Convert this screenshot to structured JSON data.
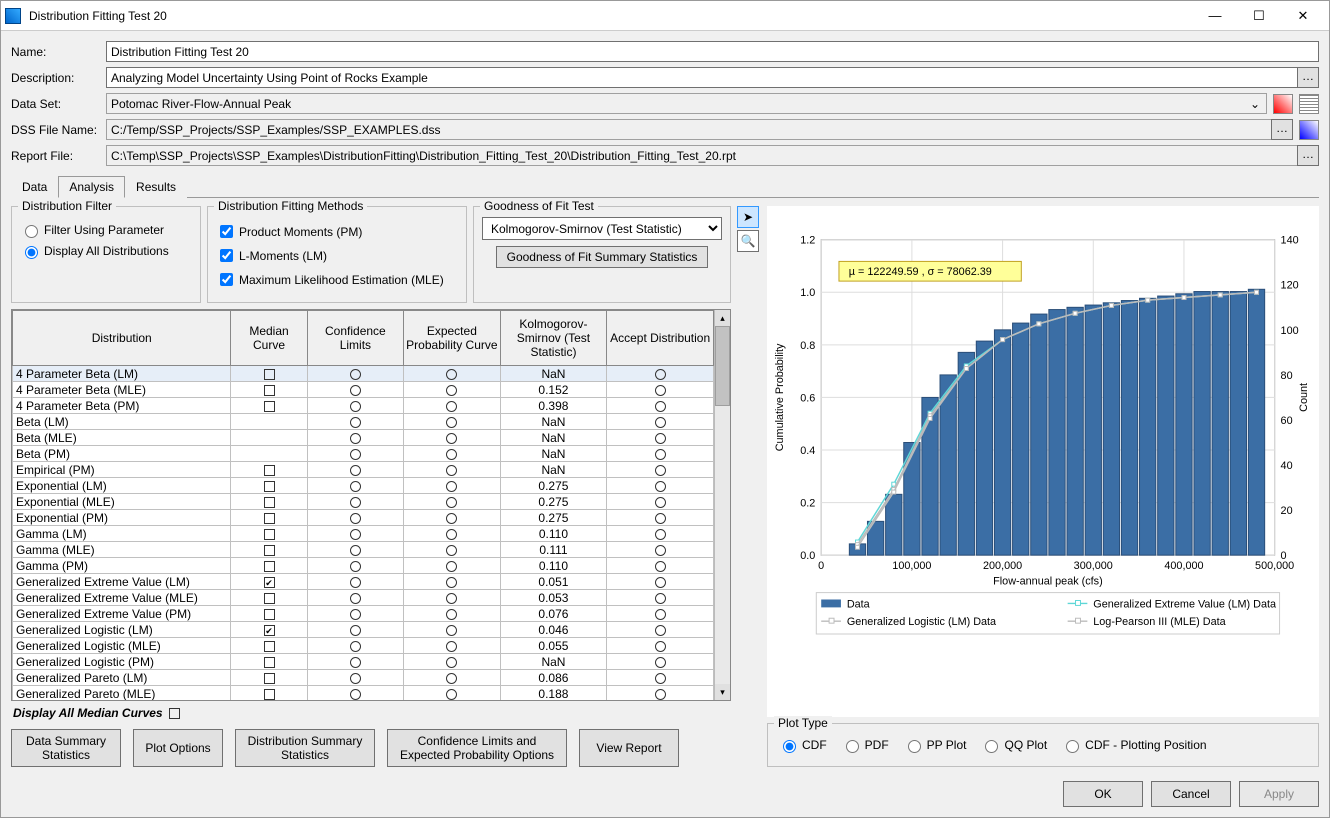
{
  "window_title": "Distribution Fitting Test 20",
  "form": {
    "name_label": "Name:",
    "name_value": "Distribution Fitting Test 20",
    "desc_label": "Description:",
    "desc_value": "Analyzing Model Uncertainty Using Point of Rocks Example",
    "dataset_label": "Data Set:",
    "dataset_value": "Potomac River-Flow-Annual Peak",
    "dss_label": "DSS File Name:",
    "dss_value": "C:/Temp/SSP_Projects/SSP_Examples/SSP_EXAMPLES.dss",
    "report_label": "Report File:",
    "report_value": "C:\\Temp\\SSP_Projects\\SSP_Examples\\DistributionFitting\\Distribution_Fitting_Test_20\\Distribution_Fitting_Test_20.rpt"
  },
  "tabs": {
    "data": "Data",
    "analysis": "Analysis",
    "results": "Results"
  },
  "filter_group": {
    "title": "Distribution Filter",
    "using_param": "Filter Using Parameter",
    "display_all": "Display All Distributions"
  },
  "methods_group": {
    "title": "Distribution Fitting Methods",
    "pm": "Product Moments (PM)",
    "lm": "L-Moments (LM)",
    "mle": "Maximum Likelihood Estimation (MLE)"
  },
  "gof_group": {
    "title": "Goodness of Fit Test",
    "selected": "Kolmogorov-Smirnov (Test Statistic)",
    "summary_btn": "Goodness of Fit Summary Statistics"
  },
  "table": {
    "headers": {
      "dist": "Distribution",
      "median": "Median Curve",
      "conf": "Confidence Limits",
      "exp": "Expected Probability Curve",
      "ks": "Kolmogorov-Smirnov (Test Statistic)",
      "accept": "Accept Distribution"
    },
    "rows": [
      {
        "name": "4 Parameter Beta (LM)",
        "median": false,
        "ks": "NaN"
      },
      {
        "name": "4 Parameter Beta (MLE)",
        "median": false,
        "ks": "0.152"
      },
      {
        "name": "4 Parameter Beta (PM)",
        "median": false,
        "ks": "0.398"
      },
      {
        "name": "Beta (LM)",
        "median": null,
        "ks": "NaN"
      },
      {
        "name": "Beta (MLE)",
        "median": null,
        "ks": "NaN"
      },
      {
        "name": "Beta (PM)",
        "median": null,
        "ks": "NaN"
      },
      {
        "name": "Empirical (PM)",
        "median": false,
        "ks": "NaN"
      },
      {
        "name": "Exponential (LM)",
        "median": false,
        "ks": "0.275"
      },
      {
        "name": "Exponential (MLE)",
        "median": false,
        "ks": "0.275"
      },
      {
        "name": "Exponential (PM)",
        "median": false,
        "ks": "0.275"
      },
      {
        "name": "Gamma (LM)",
        "median": false,
        "ks": "0.110"
      },
      {
        "name": "Gamma (MLE)",
        "median": false,
        "ks": "0.111"
      },
      {
        "name": "Gamma (PM)",
        "median": false,
        "ks": "0.110"
      },
      {
        "name": "Generalized Extreme Value (LM)",
        "median": true,
        "ks": "0.051"
      },
      {
        "name": "Generalized Extreme Value (MLE)",
        "median": false,
        "ks": "0.053"
      },
      {
        "name": "Generalized Extreme Value (PM)",
        "median": false,
        "ks": "0.076"
      },
      {
        "name": "Generalized Logistic (LM)",
        "median": true,
        "ks": "0.046"
      },
      {
        "name": "Generalized Logistic (MLE)",
        "median": false,
        "ks": "0.055"
      },
      {
        "name": "Generalized Logistic (PM)",
        "median": false,
        "ks": "NaN"
      },
      {
        "name": "Generalized Pareto (LM)",
        "median": false,
        "ks": "0.086"
      },
      {
        "name": "Generalized Pareto (MLE)",
        "median": false,
        "ks": "0.188"
      }
    ]
  },
  "display_all_median": "Display All Median Curves",
  "bottom_buttons": {
    "data_summary": "Data Summary Statistics",
    "plot_options": "Plot Options",
    "dist_summary": "Distribution Summary Statistics",
    "conf_exp": "Confidence Limits and Expected Probability Options",
    "view_report": "View Report"
  },
  "chart_annotation": "µ = 122249.59 , σ = 78062.39",
  "legend": {
    "data": "Data",
    "gev": "Generalized Extreme Value (LM) Data",
    "glog": "Generalized Logistic (LM) Data",
    "lp3": "Log-Pearson III (MLE) Data"
  },
  "axes": {
    "left": "Cumulative Probability",
    "bottom": "Flow-annual peak (cfs)",
    "right": "Count"
  },
  "plot_type": {
    "title": "Plot Type",
    "cdf": "CDF",
    "pdf": "PDF",
    "pp": "PP Plot",
    "qq": "QQ Plot",
    "cdfpp": "CDF - Plotting Position"
  },
  "footer": {
    "ok": "OK",
    "cancel": "Cancel",
    "apply": "Apply"
  },
  "chart_data": {
    "type": "bar+line",
    "title": "",
    "xlabel": "Flow-annual peak (cfs)",
    "ylabel_left": "Cumulative Probability",
    "ylabel_right": "Count",
    "xlim": [
      0,
      500000
    ],
    "ylim_left": [
      0.0,
      1.2
    ],
    "ylim_right": [
      0,
      140
    ],
    "xticks": [
      0,
      100000,
      200000,
      300000,
      400000,
      500000
    ],
    "yticks_left": [
      0.0,
      0.2,
      0.4,
      0.6,
      0.8,
      1.0,
      1.2
    ],
    "yticks_right": [
      0,
      20,
      40,
      60,
      80,
      100,
      120,
      140
    ],
    "bars": {
      "name": "Data",
      "axis": "right",
      "bin_centers": [
        40000,
        60000,
        80000,
        100000,
        120000,
        140000,
        160000,
        180000,
        200000,
        220000,
        240000,
        260000,
        280000,
        300000,
        320000,
        340000,
        360000,
        380000,
        400000,
        420000,
        440000,
        460000,
        480000
      ],
      "counts": [
        5,
        15,
        27,
        50,
        70,
        80,
        90,
        95,
        100,
        103,
        107,
        109,
        110,
        111,
        112,
        113,
        114,
        115,
        116,
        117,
        117,
        117,
        118
      ]
    },
    "series": [
      {
        "name": "Generalized Extreme Value (LM) Data",
        "axis": "left",
        "x": [
          40000,
          80000,
          120000,
          160000,
          200000,
          240000,
          280000,
          320000,
          360000,
          400000,
          440000,
          480000
        ],
        "y": [
          0.05,
          0.27,
          0.54,
          0.72,
          0.82,
          0.88,
          0.92,
          0.95,
          0.97,
          0.98,
          0.99,
          1.0
        ]
      },
      {
        "name": "Generalized Logistic (LM) Data",
        "axis": "left",
        "x": [
          40000,
          80000,
          120000,
          160000,
          200000,
          240000,
          280000,
          320000,
          360000,
          400000,
          440000,
          480000
        ],
        "y": [
          0.04,
          0.25,
          0.53,
          0.71,
          0.82,
          0.88,
          0.92,
          0.95,
          0.97,
          0.98,
          0.99,
          1.0
        ]
      },
      {
        "name": "Log-Pearson III (MLE) Data",
        "axis": "left",
        "x": [
          40000,
          80000,
          120000,
          160000,
          200000,
          240000,
          280000,
          320000,
          360000,
          400000,
          440000,
          480000
        ],
        "y": [
          0.03,
          0.24,
          0.52,
          0.71,
          0.82,
          0.88,
          0.92,
          0.95,
          0.97,
          0.98,
          0.99,
          1.0
        ]
      }
    ]
  }
}
